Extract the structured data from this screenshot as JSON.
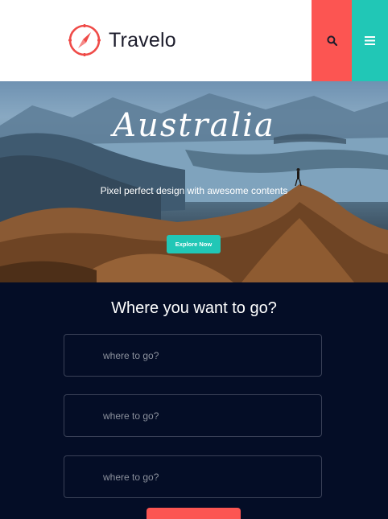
{
  "header": {
    "brand": "Travelo",
    "search_icon": "search-icon",
    "menu_icon": "hamburger-menu-icon",
    "colors": {
      "search_bg": "#fc5552",
      "menu_bg": "#21c7b6",
      "logo_accent": "#ef4b48"
    }
  },
  "hero": {
    "title": "Australia",
    "subtitle": "Pixel perfect design with awesome contents",
    "cta_label": "Explore Now"
  },
  "search": {
    "title": "Where you want to go?",
    "fields": [
      {
        "placeholder": "where to go?"
      },
      {
        "placeholder": "where to go?"
      },
      {
        "placeholder": "where to go?"
      }
    ],
    "colors": {
      "section_bg": "#040d26",
      "field_border": "#3a4157",
      "submit_bg": "#fc5552"
    }
  }
}
